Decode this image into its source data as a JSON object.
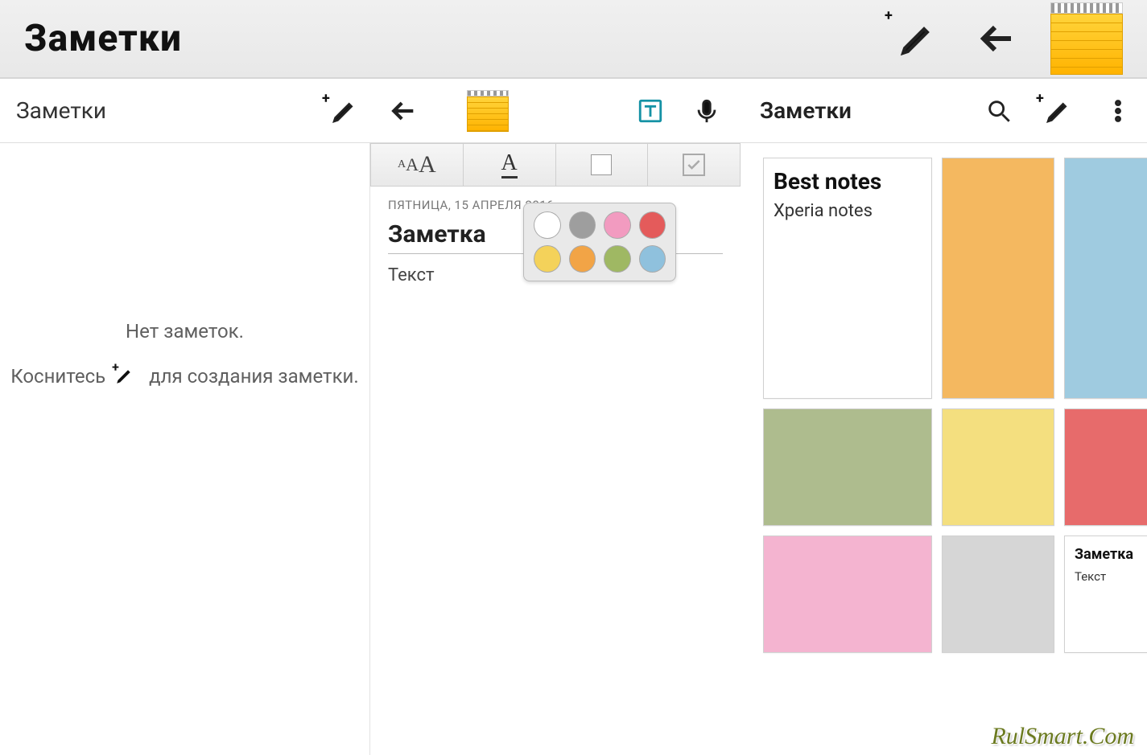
{
  "app": {
    "title": "Заметки"
  },
  "left": {
    "title": "Заметки",
    "empty_line1": "Нет заметок.",
    "empty_prefix": "Коснитесь",
    "empty_suffix": "для создания заметки."
  },
  "right": {
    "title": "Заметки"
  },
  "editor": {
    "date": "ПЯТНИЦА, 15 АПРЕЛЯ 2016",
    "title": "Заметка",
    "body": "Текст"
  },
  "color_picker": {
    "row1": [
      "#ffffff",
      "#9e9e9e",
      "#f29bc0",
      "#e45b5b"
    ],
    "row2": [
      "#f4d25a",
      "#f2a446",
      "#9fb863",
      "#8fc1dd"
    ]
  },
  "grid": {
    "best_title": "Best notes",
    "best_sub": "Xperia notes",
    "note_title": "Заметка",
    "note_body": "Текст"
  },
  "watermark": "RulSmart.Com"
}
